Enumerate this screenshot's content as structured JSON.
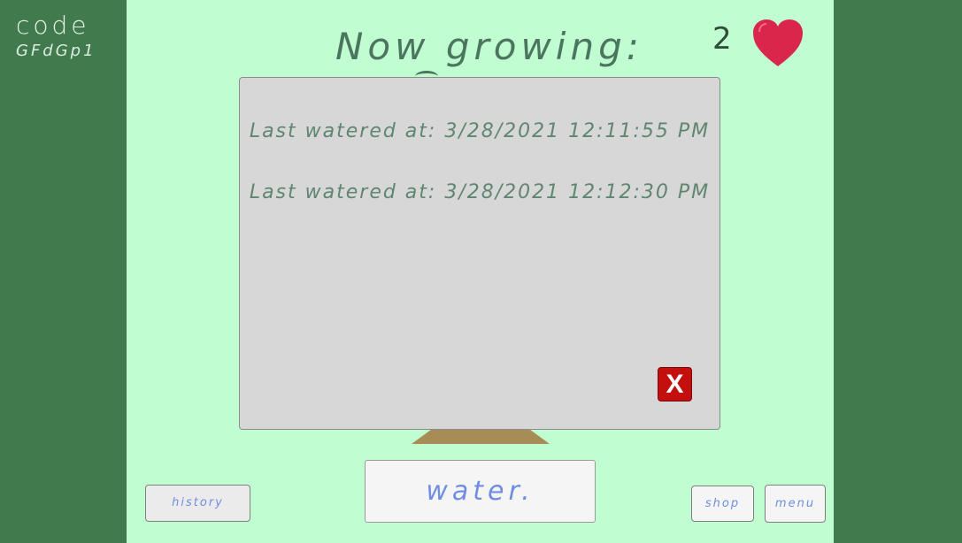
{
  "code": {
    "label": "code",
    "value": "GFdGp1"
  },
  "header": {
    "title": "Now growing:",
    "hearts_count": "2"
  },
  "modal": {
    "entries": [
      "Last watered at: 3/28/2021 12:11:55 PM",
      "Last watered at: 3/28/2021 12:12:30 PM"
    ],
    "close_label": "X"
  },
  "actions": {
    "water_label": "water.",
    "history_label": "history",
    "shop_label": "shop",
    "menu_label": "menu"
  },
  "colors": {
    "outer_bg": "#417a4d",
    "stage_bg": "#c0fdd0",
    "modal_bg": "#d7d7d7",
    "close_red": "#c40f0f",
    "heart": "#d9264a",
    "button_text": "#6f8ee3"
  },
  "icons": {
    "heart": "heart-icon"
  }
}
